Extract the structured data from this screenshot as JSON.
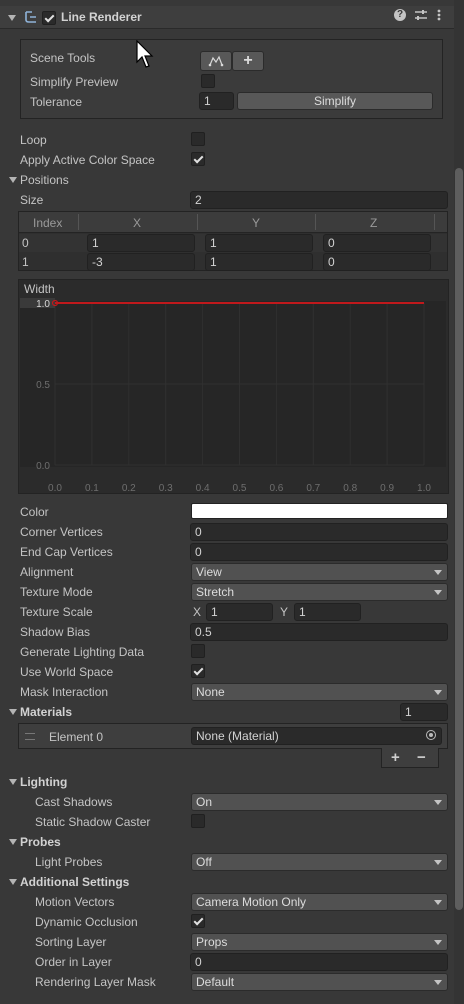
{
  "component": {
    "title": "Line Renderer",
    "enabled": true,
    "icons": [
      "help-icon",
      "preset-icon",
      "more-icon"
    ]
  },
  "scene_tools": {
    "label": "Scene Tools",
    "simplify_preview_label": "Simplify Preview",
    "simplify_preview_checked": false,
    "tolerance_label": "Tolerance",
    "tolerance_value": "1",
    "simplify_button": "Simplify",
    "plus_glyph": "+"
  },
  "loop": {
    "label": "Loop",
    "checked": false
  },
  "apply_active_color_space": {
    "label": "Apply Active Color Space",
    "checked": true
  },
  "positions": {
    "label": "Positions",
    "size_label": "Size",
    "size_value": "2",
    "columns": [
      "Index",
      "X",
      "Y",
      "Z"
    ],
    "rows": [
      {
        "index": "0",
        "x": "1",
        "y": "1",
        "z": "0"
      },
      {
        "index": "1",
        "x": "-3",
        "y": "1",
        "z": "0"
      }
    ]
  },
  "width_curve": {
    "label": "Width",
    "y_labels": [
      "1.0",
      "0.5",
      "0.0"
    ],
    "x_labels": [
      "0.0",
      "0.1",
      "0.2",
      "0.3",
      "0.4",
      "0.5",
      "0.6",
      "0.7",
      "0.8",
      "0.9",
      "1.0"
    ],
    "curve_color": "#c0191c",
    "chart_data": {
      "type": "line",
      "x": [
        0.0,
        1.0
      ],
      "series": [
        {
          "values": [
            1.0,
            1.0
          ]
        }
      ],
      "xlim": [
        0.0,
        1.0
      ],
      "ylim": [
        0.0,
        1.0
      ]
    }
  },
  "properties": {
    "color_label": "Color",
    "color_value": "#ffffff",
    "corner_vertices_label": "Corner Vertices",
    "corner_vertices_value": "0",
    "end_cap_vertices_label": "End Cap Vertices",
    "end_cap_vertices_value": "0",
    "alignment_label": "Alignment",
    "alignment_value": "View",
    "texture_mode_label": "Texture Mode",
    "texture_mode_value": "Stretch",
    "texture_scale_label": "Texture Scale",
    "texture_scale_x_label": "X",
    "texture_scale_x": "1",
    "texture_scale_y_label": "Y",
    "texture_scale_y": "1",
    "shadow_bias_label": "Shadow Bias",
    "shadow_bias_value": "0.5",
    "generate_lighting_label": "Generate Lighting Data",
    "generate_lighting_checked": false,
    "use_world_space_label": "Use World Space",
    "use_world_space_checked": true,
    "mask_interaction_label": "Mask Interaction",
    "mask_interaction_value": "None"
  },
  "materials": {
    "label": "Materials",
    "count": "1",
    "element_label": "Element 0",
    "element_value": "None (Material)",
    "add_glyph": "+",
    "remove_glyph": "−"
  },
  "lighting": {
    "label": "Lighting",
    "cast_shadows_label": "Cast Shadows",
    "cast_shadows_value": "On",
    "static_shadow_label": "Static Shadow Caster",
    "static_shadow_checked": false
  },
  "probes": {
    "label": "Probes",
    "light_probes_label": "Light Probes",
    "light_probes_value": "Off"
  },
  "additional": {
    "label": "Additional Settings",
    "motion_vectors_label": "Motion Vectors",
    "motion_vectors_value": "Camera Motion Only",
    "dynamic_occlusion_label": "Dynamic Occlusion",
    "dynamic_occlusion_checked": true,
    "sorting_layer_label": "Sorting Layer",
    "sorting_layer_value": "Props",
    "order_in_layer_label": "Order in Layer",
    "order_in_layer_value": "0",
    "rendering_layer_mask_label": "Rendering Layer Mask",
    "rendering_layer_mask_value": "Default"
  }
}
